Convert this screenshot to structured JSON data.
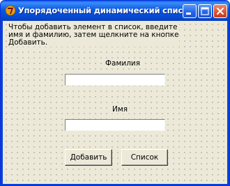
{
  "window": {
    "title": "Упорядоченный динамический список"
  },
  "form": {
    "instructions": [
      "Чтобы добавить элемент в список, введите",
      "имя и фамилию, затем щелкните на кнопке",
      "Добавить."
    ],
    "surname_label": "Фамилия",
    "surname_value": "",
    "name_label": "Имя",
    "name_value": "",
    "add_button": "Добавить",
    "list_button": "Список"
  },
  "colors": {
    "title_bar": "#0a58e0",
    "client_bg": "#ece9d8",
    "close_button": "#d8532f"
  }
}
